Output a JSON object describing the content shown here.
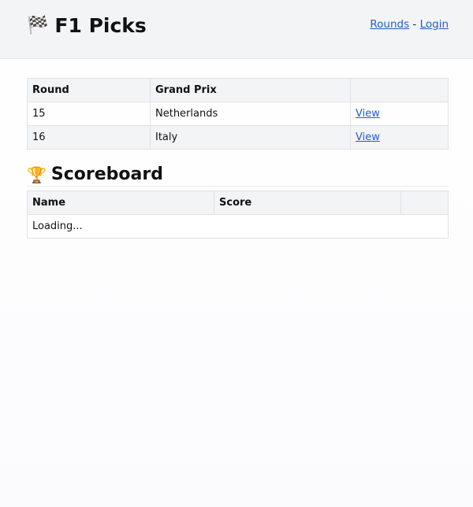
{
  "header": {
    "title": "F1 Picks",
    "nav": {
      "rounds": "Rounds",
      "separator": "-",
      "login": "Login"
    }
  },
  "rounds_table": {
    "headers": [
      "Round",
      "Grand Prix",
      ""
    ],
    "rows": [
      {
        "round": "15",
        "grand_prix": "Netherlands",
        "action": "View"
      },
      {
        "round": "16",
        "grand_prix": "Italy",
        "action": "View"
      }
    ]
  },
  "scoreboard": {
    "title": "Scoreboard",
    "headers": [
      "Name",
      "Score",
      ""
    ],
    "loading": "Loading..."
  }
}
